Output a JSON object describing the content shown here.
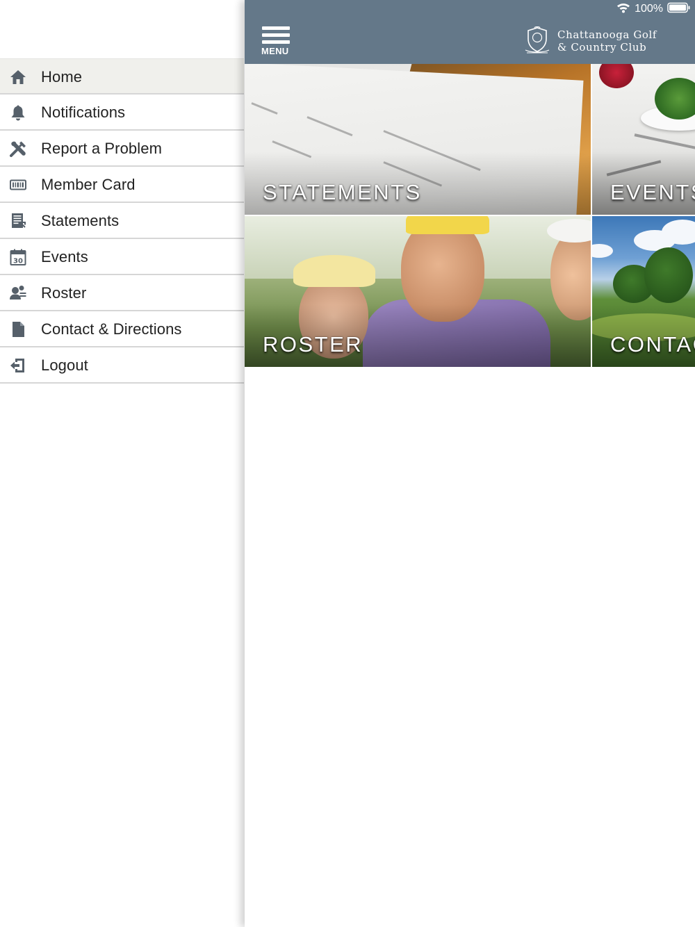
{
  "status_bar": {
    "battery_percent": "100%",
    "icons": [
      "wifi-icon",
      "battery-icon"
    ]
  },
  "header": {
    "menu_label": "MENU",
    "club_name_line1": "Chattanooga Golf",
    "club_name_line2": "& Country Club",
    "bar_color": "#647889"
  },
  "drawer": {
    "items": [
      {
        "label": "Home",
        "icon": "home-icon",
        "active": true
      },
      {
        "label": "Notifications",
        "icon": "bell-icon"
      },
      {
        "label": "Report a Problem",
        "icon": "tools-icon"
      },
      {
        "label": "Member Card",
        "icon": "member-card-icon"
      },
      {
        "label": "Statements",
        "icon": "statement-icon"
      },
      {
        "label": "Events",
        "icon": "calendar-icon",
        "icon_text": "30"
      },
      {
        "label": "Roster",
        "icon": "roster-icon"
      },
      {
        "label": "Contact & Directions",
        "icon": "document-icon"
      },
      {
        "label": "Logout",
        "icon": "logout-icon"
      }
    ],
    "active_bg": "#f0f0ec",
    "icon_color": "#56606a"
  },
  "tiles": [
    {
      "caption": "STATEMENTS"
    },
    {
      "caption": "EVENTS"
    },
    {
      "caption": "ROSTER"
    },
    {
      "caption": "CONTACT"
    }
  ]
}
